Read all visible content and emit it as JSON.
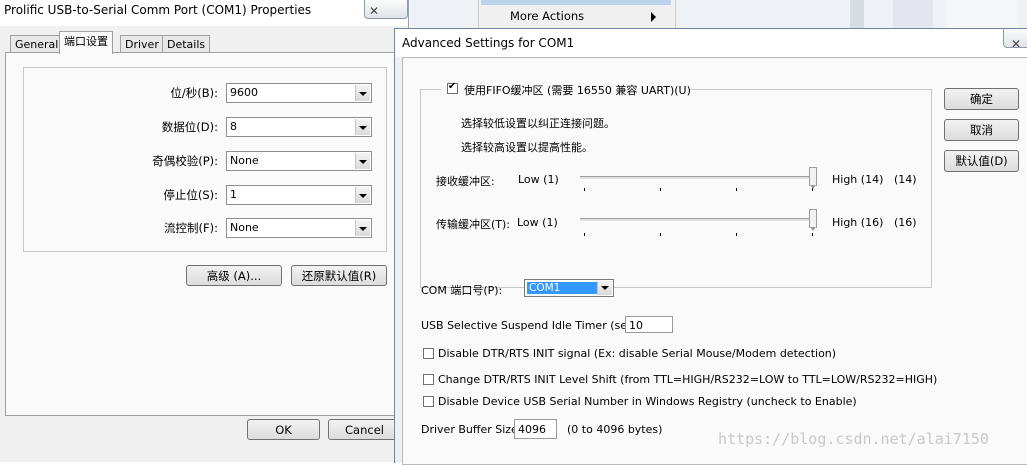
{
  "background": {
    "more_actions": "More Actions"
  },
  "properties_dialog": {
    "title": "Prolific USB-to-Serial Comm Port (COM1) Properties",
    "tabs": [
      "General",
      "端口设置",
      "Driver",
      "Details"
    ],
    "active_tab": "端口设置",
    "fields": [
      {
        "label": "位/秒(B):",
        "value": "9600"
      },
      {
        "label": "数据位(D):",
        "value": "8"
      },
      {
        "label": "奇偶校验(P):",
        "value": "None"
      },
      {
        "label": "停止位(S):",
        "value": "1"
      },
      {
        "label": "流控制(F):",
        "value": "None"
      }
    ],
    "advanced_button": "高级 (A)...",
    "restore_defaults_button": "还原默认值(R)",
    "ok_button": "OK",
    "cancel_button": "Cancel"
  },
  "advanced_dialog": {
    "title": "Advanced Settings for COM1",
    "fifo": {
      "checkbox_label": "使用FIFO缓冲区 (需要 16550 兼容 UART)(U)",
      "checked": true,
      "hint_low": "选择较低设置以纠正连接问题。",
      "hint_high": "选择较高设置以提高性能。",
      "receive": {
        "label": "接收缓冲区:",
        "low": "Low (1)",
        "high": "High (14)",
        "value": "(14)",
        "level": 1.0
      },
      "transmit": {
        "label": "传输缓冲区(T):",
        "low": "Low (1)",
        "high": "High (16)",
        "value": "(16)",
        "level": 1.0
      }
    },
    "com_port": {
      "label": "COM 端口号(P):",
      "value": "COM1"
    },
    "usb_suspend": {
      "label": "USB Selective Suspend Idle Timer (secs):",
      "value": "10"
    },
    "options": [
      {
        "label": "Disable DTR/RTS INIT signal (Ex: disable Serial Mouse/Modem detection)",
        "checked": false
      },
      {
        "label": "Change DTR/RTS INIT Level Shift (from TTL=HIGH/RS232=LOW to TTL=LOW/RS232=HIGH)",
        "checked": false
      },
      {
        "label": "Disable Device USB Serial Number in Windows Registry (uncheck to Enable)",
        "checked": false
      }
    ],
    "driver_buffer": {
      "label": "Driver Buffer Size:",
      "value": "4096",
      "range": "(0 to 4096 bytes)"
    },
    "ok_button": "确定",
    "cancel_button": "取消",
    "defaults_button": "默认值(D)"
  },
  "watermark": "https://blog.csdn.net/alai7150"
}
